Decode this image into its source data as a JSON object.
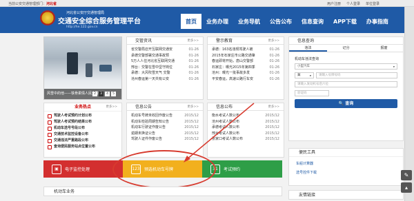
{
  "topbar": {
    "location_prefix": "当前公安交通管理部门：",
    "location": "河北省",
    "user_center": "用户注册",
    "login": "个人登录",
    "corp_login": "单位登录"
  },
  "header": {
    "org": "河北省公安厅交通管理局",
    "title": "交通安全综合服务管理平台",
    "url": "http://he.122.gov.cn"
  },
  "nav": [
    {
      "label": "首页",
      "active": true
    },
    {
      "label": "业务办理",
      "active": false
    },
    {
      "label": "业务导航",
      "active": false
    },
    {
      "label": "公告公布",
      "active": false
    },
    {
      "label": "信息查询",
      "active": false
    },
    {
      "label": "APP下载",
      "active": false
    },
    {
      "label": "办事指南",
      "active": false
    }
  ],
  "photo": {
    "caption": "风雪中的他——铁骨柔情人民交警",
    "pages": [
      "1",
      "2",
      "3",
      "4",
      "5"
    ],
    "active_page": "3"
  },
  "news_panel": {
    "title": "交管资讯",
    "more": "更多>>",
    "items": [
      {
        "text": "省交警局召开互联网交通安",
        "date": "01-26"
      },
      {
        "text": "承德交警部署交通事故预",
        "date": "01-26"
      },
      {
        "text": "5万人人住河北省互联网交通",
        "date": "01-26"
      },
      {
        "text": "邢台：交警在雪中坚守岗位",
        "date": "01-26"
      },
      {
        "text": "承德：大风吹雪天气 交警",
        "date": "01-26"
      },
      {
        "text": "沧州春运第一天共有公安",
        "date": "01-26"
      }
    ]
  },
  "warning_panel": {
    "title": "警示教育",
    "more": "更多>>",
    "items": [
      {
        "text": "承德：163名违规驾驶人被",
        "date": "01-26"
      },
      {
        "text": "2015年石家庄市公路交通肇",
        "date": "01-26"
      },
      {
        "text": "春运即将开始，唐山交警部",
        "date": "01-26"
      },
      {
        "text": "石家庄：曝光2015年第四季",
        "date": "01-26"
      },
      {
        "text": "沧州：曝光一批事故多发",
        "date": "01-26"
      },
      {
        "text": "平安春运，高速公路行车安",
        "date": "01-26"
      }
    ]
  },
  "services": {
    "title": "业务热点",
    "more": "更多>>",
    "items": [
      "驾驶人考试预约计划公布",
      "驾驶人考试预约结果公布",
      "机动车选号号段公布",
      "交通技术监控设备公布",
      "交通违法严重路段公布",
      "查询便民服务站点位置公布"
    ]
  },
  "notice_panel": {
    "title": "信息公告",
    "more": "更多>>",
    "items": [
      {
        "text": "机动车号牌未收回作废公告",
        "date": "2015/12"
      },
      {
        "text": "机动车检验周期告知公告",
        "date": "2015/12"
      },
      {
        "text": "机动车行驶证作废公告",
        "date": "2015/12"
      },
      {
        "text": "逾期未换证公告",
        "date": "2015/12"
      },
      {
        "text": "驾驶人证件作废公告",
        "date": "2015/12"
      }
    ]
  },
  "stats_panel": {
    "title": "信息公布",
    "more": "更多>>",
    "items": [
      {
        "text": "衡水考试人数公布",
        "date": "2015/12"
      },
      {
        "text": "沧州考试人数公布",
        "date": "2015/12"
      },
      {
        "text": "承德考试人数公布",
        "date": "2015/12"
      },
      {
        "text": "邢台考试人数公布",
        "date": "2015/12"
      },
      {
        "text": "张家口考试人数公布",
        "date": "2015/12"
      }
    ]
  },
  "query": {
    "title": "信息查询",
    "tabs": [
      "违法",
      "记分",
      "报废"
    ],
    "active_tab": "违法",
    "subtitle": "机动车违法查询",
    "vehicle_type": "小型汽车",
    "province": "冀",
    "plate_placeholder": "请输入号牌号码",
    "engine_placeholder": "请输入发动机号后六位",
    "captcha_placeholder": "验证码",
    "button": "查询"
  },
  "tiles": [
    {
      "label": "电子监控处理",
      "color": "#d32f2f"
    },
    {
      "label": "预选机动车号牌",
      "color": "#f2b01e"
    },
    {
      "label": "考试预约",
      "color": "#2e9e47"
    }
  ],
  "bottom_section": "机动车业务",
  "tools": {
    "title": "便民工具",
    "items": [
      "车船计算器",
      "选号控件下载"
    ]
  },
  "links": {
    "title": "友情链接"
  },
  "accent": "#1f5aa6",
  "annotation_color": "#d73b2f"
}
